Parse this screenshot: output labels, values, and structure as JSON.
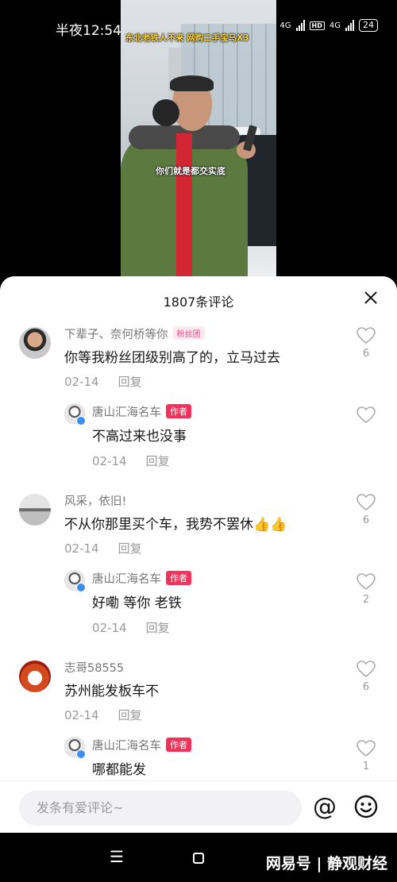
{
  "status_bar": {
    "time": "半夜12:54",
    "network_1": "4G",
    "network_2": "4G",
    "hd_1": "HD",
    "hd_2": "HD",
    "battery": "24"
  },
  "video": {
    "title_overlay": "东北老铁人不来 网购二手宝马X3",
    "subtitle": "你们就是都交实底"
  },
  "comments_sheet": {
    "title": "1807条评论",
    "comments": [
      {
        "user": "下辈子、奈何桥等你",
        "badge": "粉丝团",
        "text": "你等我粉丝团级别高了的，立马过去",
        "date": "02-14",
        "reply_label": "回复",
        "likes": "6",
        "reply": {
          "user": "唐山汇海名车",
          "badge": "作者",
          "text": "不高过来也没事",
          "date": "02-14",
          "reply_label": "回复",
          "likes": ""
        }
      },
      {
        "user": "风采，依旧!",
        "text": "不从你那里买个车，我势不罢休👍👍",
        "date": "02-14",
        "reply_label": "回复",
        "likes": "6",
        "reply": {
          "user": "唐山汇海名车",
          "badge": "作者",
          "text": "好嘞 等你 老铁",
          "date": "02-14",
          "reply_label": "回复",
          "likes": "2"
        }
      },
      {
        "user": "志哥58555",
        "text": "苏州能发板车不",
        "date": "02-14",
        "reply_label": "回复",
        "likes": "6",
        "reply": {
          "user": "唐山汇海名车",
          "badge": "作者",
          "text": "哪都能发",
          "likes": "1"
        }
      }
    ]
  },
  "input_bar": {
    "placeholder": "发条有爱评论~",
    "at_symbol": "@"
  },
  "nav_bar": {
    "menu_glyph": "☰",
    "watermark": "网易号 | 静观财经"
  }
}
